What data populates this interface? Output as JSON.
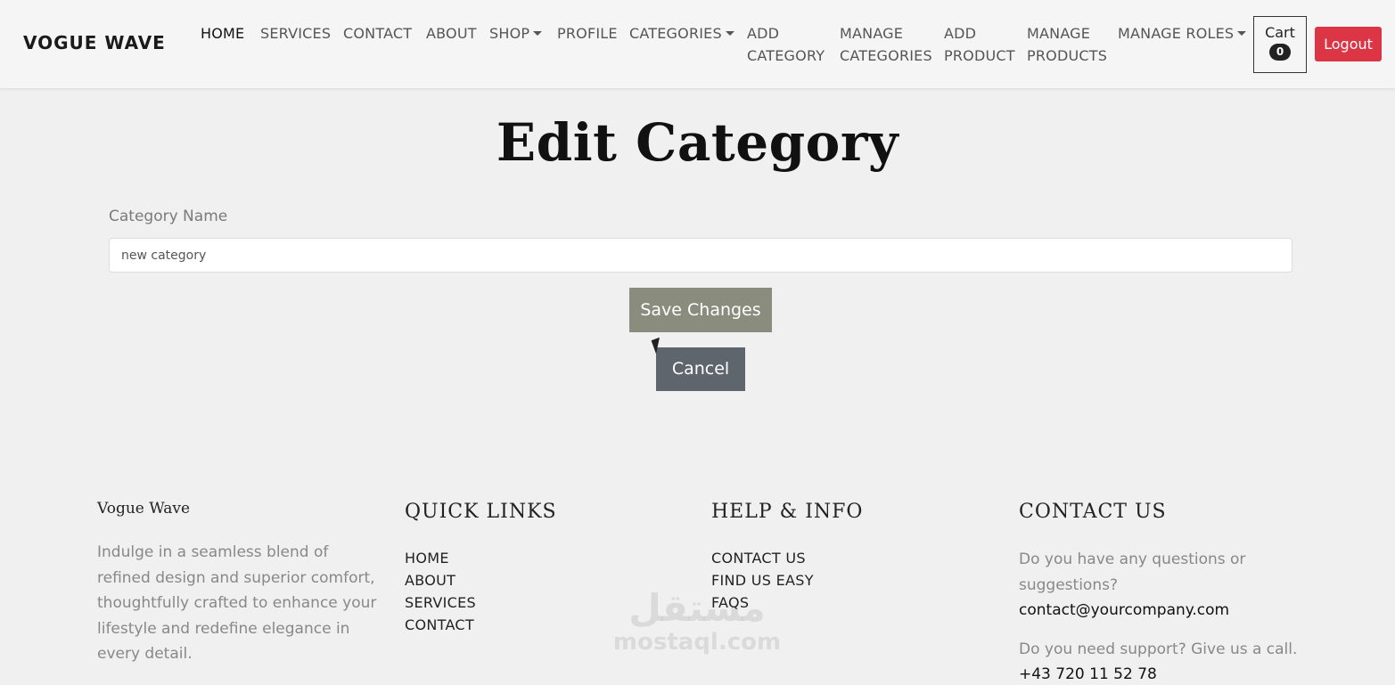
{
  "brand": "VOGUE WAVE",
  "nav": {
    "home": "HOME",
    "services": "SERVICES",
    "contact": "CONTACT",
    "about": "ABOUT",
    "shop": "SHOP",
    "profile": "PROFILE",
    "categories": "CATEGORIES",
    "add_category_1": "ADD",
    "add_category_2": "CATEGORY",
    "manage_categories_1": "MANAGE",
    "manage_categories_2": "CATEGORIES",
    "add_product_1": "ADD",
    "add_product_2": "PRODUCT",
    "manage_products_1": "MANAGE",
    "manage_products_2": "PRODUCTS",
    "manage_roles": "MANAGE ROLES",
    "cart_label": "Cart",
    "cart_count": "0",
    "logout": "Logout"
  },
  "form": {
    "title": "Edit Category",
    "label": "Category Name",
    "value": "new category",
    "save": "Save Changes",
    "cancel": "Cancel"
  },
  "footer": {
    "brand": "Vogue Wave",
    "description": "Indulge in a seamless blend of refined design and superior comfort, thoughtfully crafted to enhance your lifestyle and redefine elegance in every detail.",
    "quick_links": {
      "heading": "QUICK LINKS",
      "links": [
        "HOME",
        "ABOUT",
        "SERVICES",
        "CONTACT"
      ]
    },
    "help": {
      "heading": "HELP & INFO",
      "links": [
        "CONTACT US",
        "FIND US EASY",
        "FAQS"
      ]
    },
    "contact": {
      "heading": "CONTACT US",
      "question": "Do you have any questions or suggestions?",
      "email": "contact@yourcompany.com",
      "support": "Do you need support? Give us a call.",
      "phone": "+43 720 11 52 78"
    }
  },
  "watermark": {
    "arabic": "مستقل",
    "latin": "mostaql.com"
  }
}
